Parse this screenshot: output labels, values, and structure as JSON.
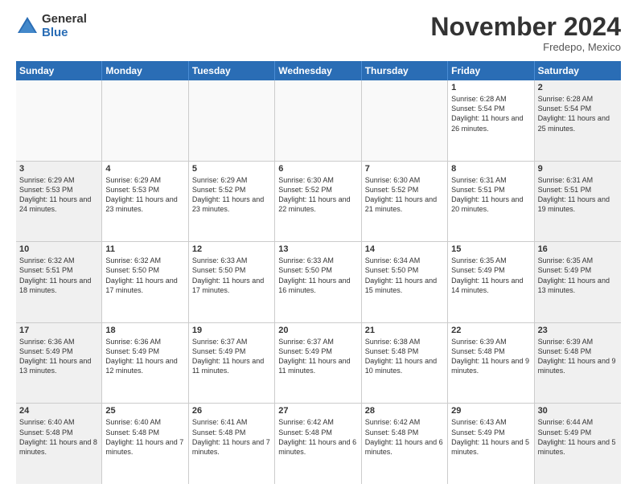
{
  "logo": {
    "general": "General",
    "blue": "Blue"
  },
  "header": {
    "month": "November 2024",
    "location": "Fredepo, Mexico"
  },
  "weekdays": [
    "Sunday",
    "Monday",
    "Tuesday",
    "Wednesday",
    "Thursday",
    "Friday",
    "Saturday"
  ],
  "weeks": [
    [
      {
        "day": "",
        "info": ""
      },
      {
        "day": "",
        "info": ""
      },
      {
        "day": "",
        "info": ""
      },
      {
        "day": "",
        "info": ""
      },
      {
        "day": "",
        "info": ""
      },
      {
        "day": "1",
        "info": "Sunrise: 6:28 AM\nSunset: 5:54 PM\nDaylight: 11 hours and 26 minutes."
      },
      {
        "day": "2",
        "info": "Sunrise: 6:28 AM\nSunset: 5:54 PM\nDaylight: 11 hours and 25 minutes."
      }
    ],
    [
      {
        "day": "3",
        "info": "Sunrise: 6:29 AM\nSunset: 5:53 PM\nDaylight: 11 hours and 24 minutes."
      },
      {
        "day": "4",
        "info": "Sunrise: 6:29 AM\nSunset: 5:53 PM\nDaylight: 11 hours and 23 minutes."
      },
      {
        "day": "5",
        "info": "Sunrise: 6:29 AM\nSunset: 5:52 PM\nDaylight: 11 hours and 23 minutes."
      },
      {
        "day": "6",
        "info": "Sunrise: 6:30 AM\nSunset: 5:52 PM\nDaylight: 11 hours and 22 minutes."
      },
      {
        "day": "7",
        "info": "Sunrise: 6:30 AM\nSunset: 5:52 PM\nDaylight: 11 hours and 21 minutes."
      },
      {
        "day": "8",
        "info": "Sunrise: 6:31 AM\nSunset: 5:51 PM\nDaylight: 11 hours and 20 minutes."
      },
      {
        "day": "9",
        "info": "Sunrise: 6:31 AM\nSunset: 5:51 PM\nDaylight: 11 hours and 19 minutes."
      }
    ],
    [
      {
        "day": "10",
        "info": "Sunrise: 6:32 AM\nSunset: 5:51 PM\nDaylight: 11 hours and 18 minutes."
      },
      {
        "day": "11",
        "info": "Sunrise: 6:32 AM\nSunset: 5:50 PM\nDaylight: 11 hours and 17 minutes."
      },
      {
        "day": "12",
        "info": "Sunrise: 6:33 AM\nSunset: 5:50 PM\nDaylight: 11 hours and 17 minutes."
      },
      {
        "day": "13",
        "info": "Sunrise: 6:33 AM\nSunset: 5:50 PM\nDaylight: 11 hours and 16 minutes."
      },
      {
        "day": "14",
        "info": "Sunrise: 6:34 AM\nSunset: 5:50 PM\nDaylight: 11 hours and 15 minutes."
      },
      {
        "day": "15",
        "info": "Sunrise: 6:35 AM\nSunset: 5:49 PM\nDaylight: 11 hours and 14 minutes."
      },
      {
        "day": "16",
        "info": "Sunrise: 6:35 AM\nSunset: 5:49 PM\nDaylight: 11 hours and 13 minutes."
      }
    ],
    [
      {
        "day": "17",
        "info": "Sunrise: 6:36 AM\nSunset: 5:49 PM\nDaylight: 11 hours and 13 minutes."
      },
      {
        "day": "18",
        "info": "Sunrise: 6:36 AM\nSunset: 5:49 PM\nDaylight: 11 hours and 12 minutes."
      },
      {
        "day": "19",
        "info": "Sunrise: 6:37 AM\nSunset: 5:49 PM\nDaylight: 11 hours and 11 minutes."
      },
      {
        "day": "20",
        "info": "Sunrise: 6:37 AM\nSunset: 5:49 PM\nDaylight: 11 hours and 11 minutes."
      },
      {
        "day": "21",
        "info": "Sunrise: 6:38 AM\nSunset: 5:48 PM\nDaylight: 11 hours and 10 minutes."
      },
      {
        "day": "22",
        "info": "Sunrise: 6:39 AM\nSunset: 5:48 PM\nDaylight: 11 hours and 9 minutes."
      },
      {
        "day": "23",
        "info": "Sunrise: 6:39 AM\nSunset: 5:48 PM\nDaylight: 11 hours and 9 minutes."
      }
    ],
    [
      {
        "day": "24",
        "info": "Sunrise: 6:40 AM\nSunset: 5:48 PM\nDaylight: 11 hours and 8 minutes."
      },
      {
        "day": "25",
        "info": "Sunrise: 6:40 AM\nSunset: 5:48 PM\nDaylight: 11 hours and 7 minutes."
      },
      {
        "day": "26",
        "info": "Sunrise: 6:41 AM\nSunset: 5:48 PM\nDaylight: 11 hours and 7 minutes."
      },
      {
        "day": "27",
        "info": "Sunrise: 6:42 AM\nSunset: 5:48 PM\nDaylight: 11 hours and 6 minutes."
      },
      {
        "day": "28",
        "info": "Sunrise: 6:42 AM\nSunset: 5:48 PM\nDaylight: 11 hours and 6 minutes."
      },
      {
        "day": "29",
        "info": "Sunrise: 6:43 AM\nSunset: 5:49 PM\nDaylight: 11 hours and 5 minutes."
      },
      {
        "day": "30",
        "info": "Sunrise: 6:44 AM\nSunset: 5:49 PM\nDaylight: 11 hours and 5 minutes."
      }
    ]
  ]
}
